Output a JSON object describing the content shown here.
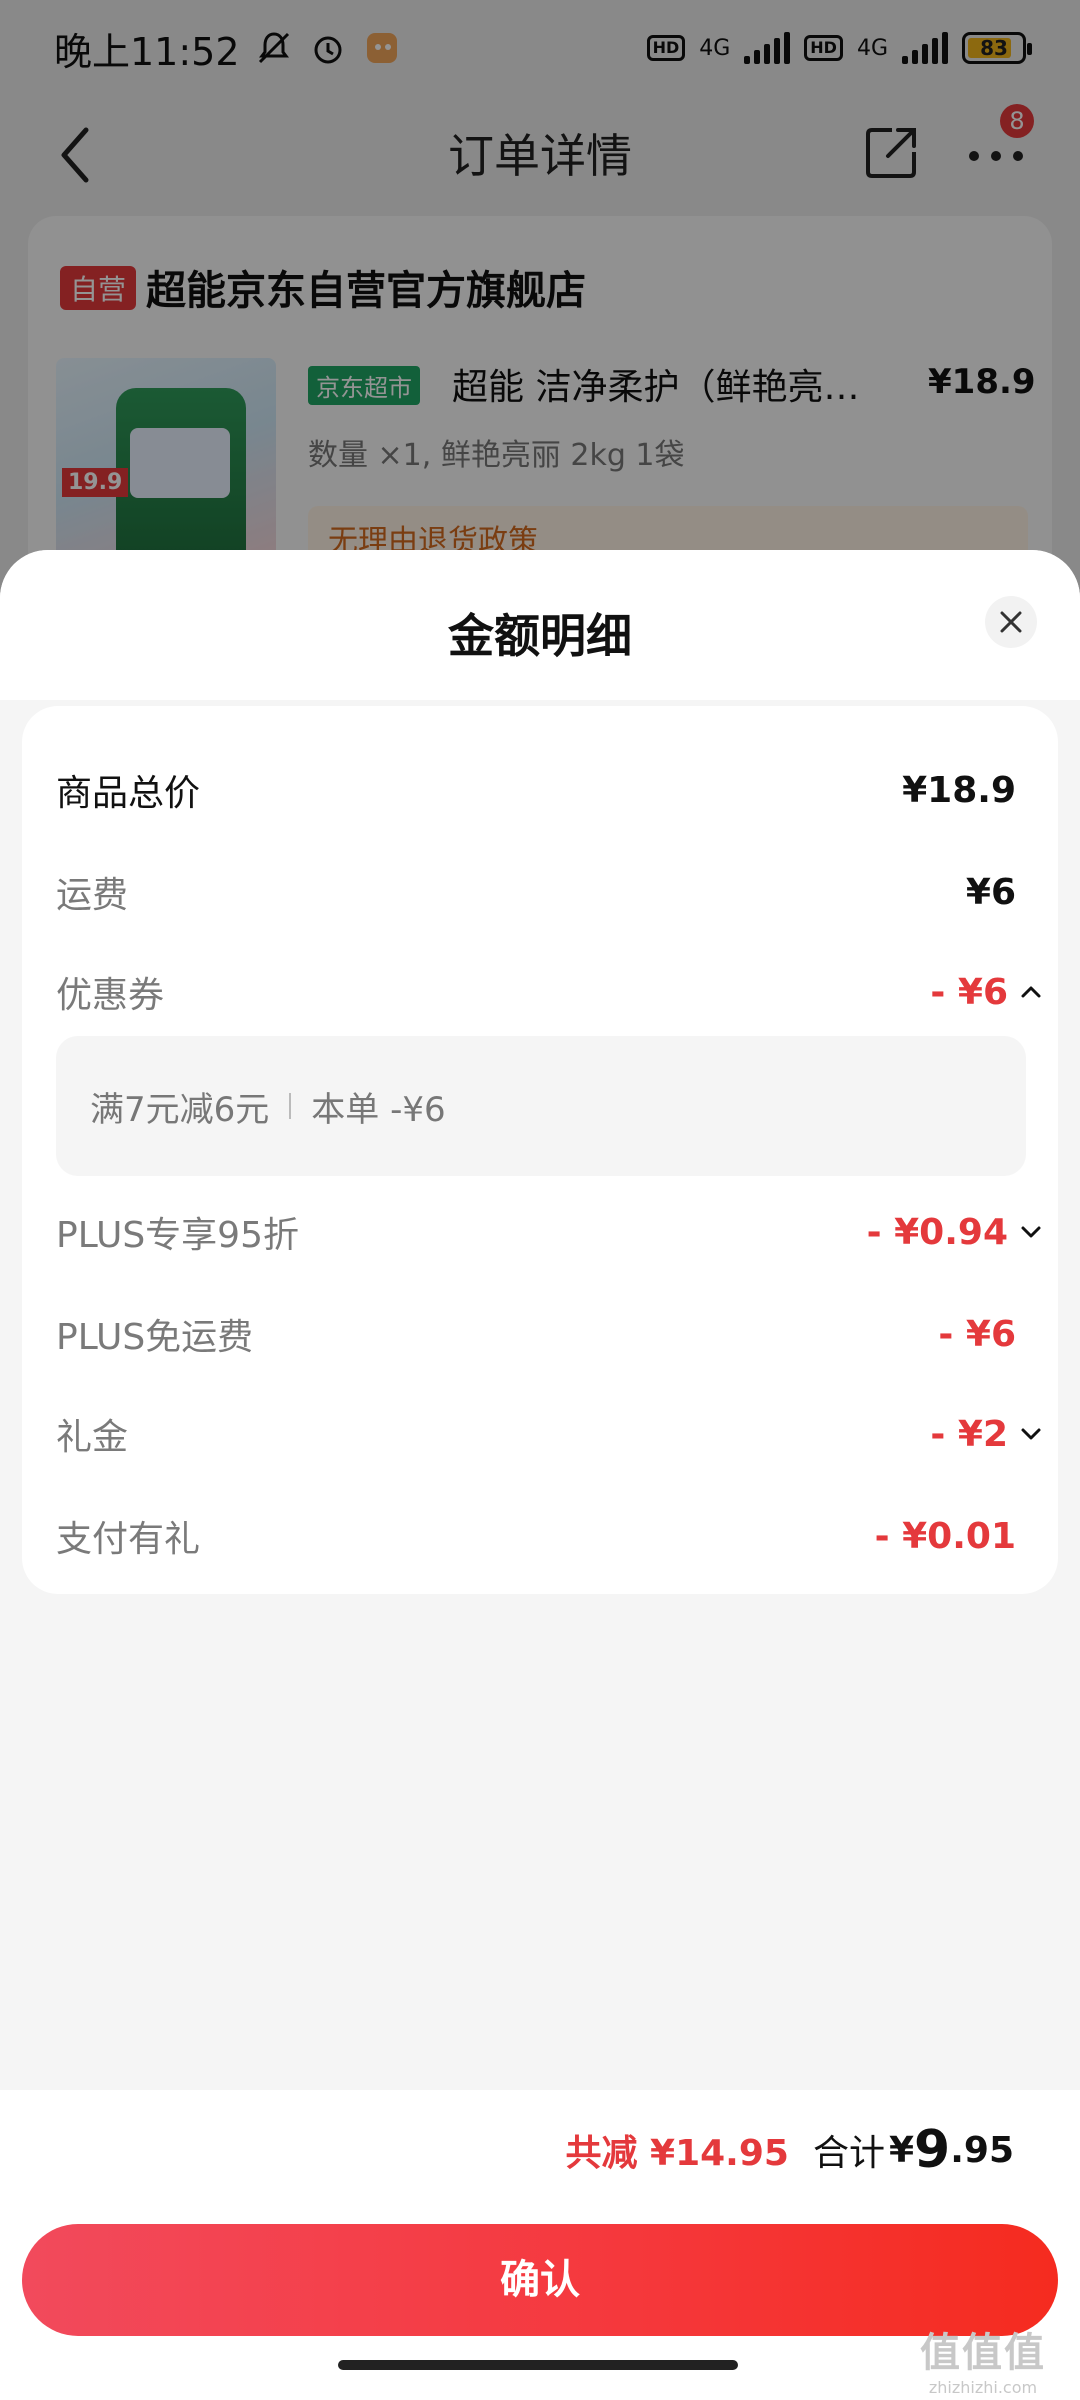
{
  "status_bar": {
    "time": "晚上11:52",
    "network_1": "4G",
    "network_2": "4G",
    "hd_1": "HD",
    "hd_2": "HD",
    "battery": "83"
  },
  "nav": {
    "title": "订单详情",
    "badge_count": "8"
  },
  "shop": {
    "tag": "自营",
    "name": "超能京东自营官方旗舰店",
    "product": {
      "channel_tag": "京东超市",
      "title": "超能 洁净柔护（鲜艳亮…",
      "price": "¥18.9",
      "spec": "数量 ×1, 鲜艳亮丽 2kg 1袋",
      "image_price": "19.9",
      "policy": "无理由退货政策"
    }
  },
  "sheet": {
    "title": "金额明细",
    "rows": [
      {
        "label": "商品总价",
        "value": "¥18.9",
        "style": "dark"
      },
      {
        "label": "运费",
        "value": "¥6",
        "style": "normal"
      },
      {
        "label": "优惠券",
        "value": "- ¥6",
        "style": "red",
        "chevron": "up"
      },
      {
        "label": "PLUS专享95折",
        "value": "- ¥0.94",
        "style": "red",
        "chevron": "down"
      },
      {
        "label": "PLUS免运费",
        "value": "- ¥6",
        "style": "red"
      },
      {
        "label": "礼金",
        "value": "- ¥2",
        "style": "red",
        "chevron": "down"
      },
      {
        "label": "支付有礼",
        "value": "- ¥0.01",
        "style": "red"
      }
    ],
    "coupon_detail": {
      "condition": "满7元减6元",
      "this_order": "本单 -¥6"
    }
  },
  "summary": {
    "saved": "共减 ¥14.95",
    "total_label": "合计",
    "total_symbol": "¥",
    "total_int": "9",
    "total_dec": ".95"
  },
  "confirm_label": "确认",
  "watermark": {
    "big": "值值值",
    "small": "zhizhizhi.com"
  },
  "colors": {
    "accent_red": "#e4393c",
    "button_gradient_start": "#f24a5c",
    "button_gradient_end": "#f52b1f",
    "jd_green": "#1fa564"
  }
}
